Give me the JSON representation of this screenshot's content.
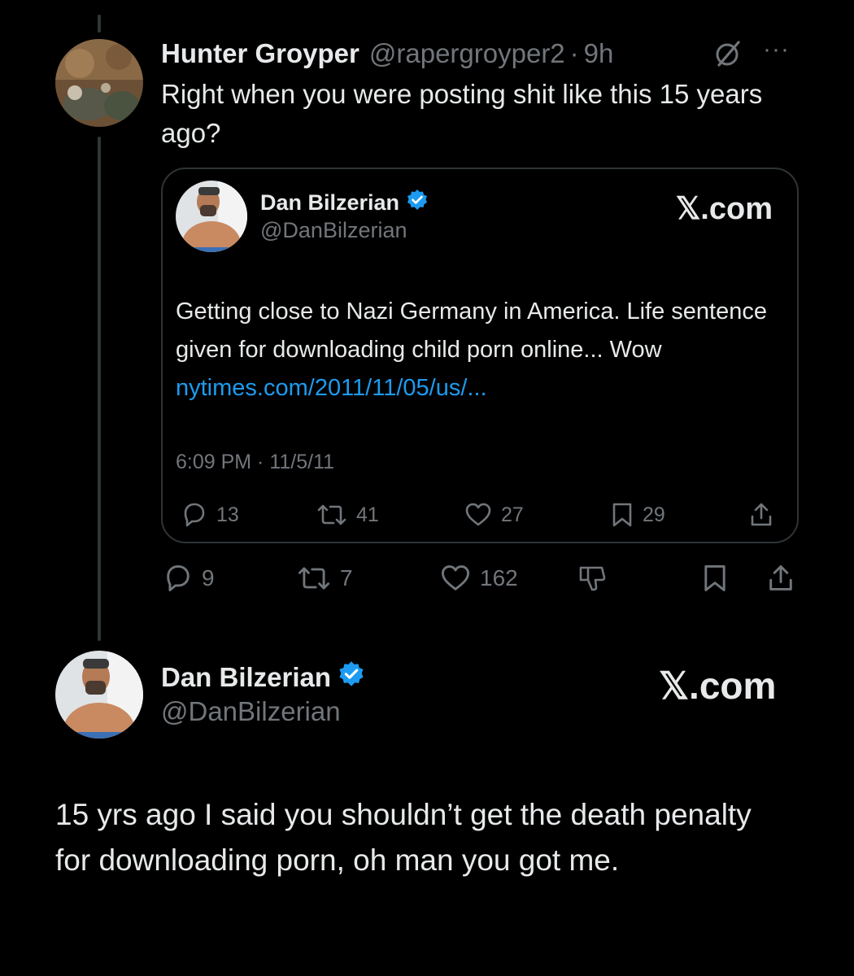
{
  "reply": {
    "display_name": "Hunter Groyper",
    "handle": "@rapergroyper2",
    "separator": "·",
    "time": "9h",
    "text": "Right when you were posting shit like this 15 years ago?",
    "icons": {
      "grok": "grok-slash-icon",
      "more": "more-options-icon"
    },
    "actions": {
      "replies": "9",
      "reposts": "7",
      "likes": "162"
    }
  },
  "quote": {
    "display_name": "Dan Bilzerian",
    "handle": "@DanBilzerian",
    "source": "𝕏.com",
    "text": "Getting close to Nazi Germany in America.  Life sentence given for downloading child porn online...  Wow ",
    "link": "nytimes.com/2011/11/05/us/...",
    "timestamp": "6:09 PM · 11/5/11",
    "actions": {
      "replies": "13",
      "reposts": "41",
      "likes": "27",
      "bookmarks": "29"
    }
  },
  "response": {
    "display_name": "Dan Bilzerian",
    "handle": "@DanBilzerian",
    "source": "𝕏.com",
    "text": "15 yrs ago I said you shouldn’t get the death penalty for downloading porn, oh man you got me."
  },
  "colors": {
    "background": "#000000",
    "text": "#e7e9ea",
    "muted": "#71767b",
    "link": "#1d9bf0",
    "verified": "#1d9bf0",
    "border": "#2f3336"
  }
}
